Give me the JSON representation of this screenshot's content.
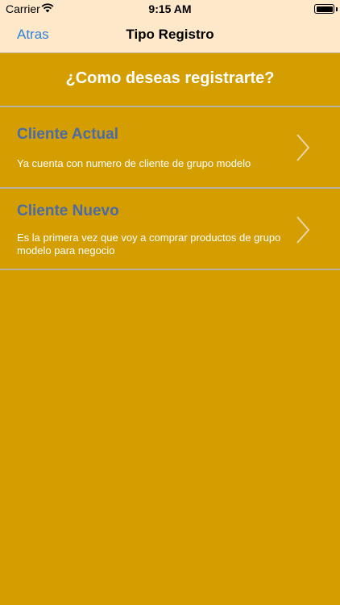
{
  "status": {
    "carrier": "Carrier",
    "time": "9:15 AM"
  },
  "nav": {
    "back_label": "Atras",
    "title": "Tipo Registro"
  },
  "main": {
    "question": "¿Como deseas registrarte?",
    "options": [
      {
        "title": "Cliente Actual",
        "subtitle": "Ya cuenta con numero de cliente de grupo modelo"
      },
      {
        "title": "Cliente Nuevo",
        "subtitle": "Es la primera vez que voy a comprar productos de grupo modelo para negocio"
      }
    ]
  },
  "icons": {
    "wifi": "wifi-icon",
    "battery": "battery-icon",
    "chevron": "chevron-right-icon"
  },
  "colors": {
    "nav_bg": "#FDE9CA",
    "page_bg": "#D49E00",
    "link": "#2F7FD8",
    "option_title": "#4A6BA8"
  }
}
